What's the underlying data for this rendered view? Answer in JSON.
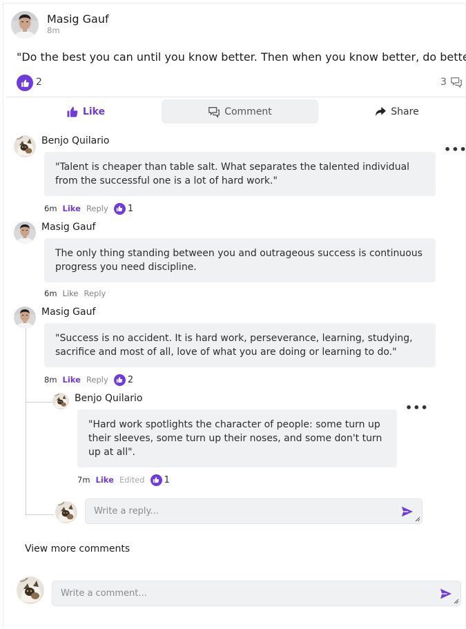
{
  "post": {
    "author": "Masig Gauf",
    "time": "8m",
    "text": "\"Do the best you can until you know better. Then when you know better, do better.\"",
    "like_count": "2",
    "comment_count": "3"
  },
  "actions": {
    "like": "Like",
    "comment": "Comment",
    "share": "Share"
  },
  "comments": [
    {
      "author": "Benjo Quilario",
      "text": "\"Talent is cheaper than table salt. What separates the talented individual from the successful one is a lot of hard work.\"",
      "time": "6m",
      "like": "Like",
      "reply": "Reply",
      "reactions": "1"
    },
    {
      "author": "Masig Gauf",
      "text": "The only thing standing between you and outrageous success is continuous progress you need discipline.",
      "time": "6m",
      "like": "Like",
      "reply": "Reply"
    },
    {
      "author": "Masig Gauf",
      "text": "\"Success is no accident. It is hard work, perseverance, learning, studying, sacrifice and most of all, love of what you are doing or learning to do.\"",
      "time": "8m",
      "like": "Like",
      "reply": "Reply",
      "reactions": "2",
      "replies": [
        {
          "author": "Benjo Quilario",
          "text": "\"Hard work spotlights the character of people: some turn up their sleeves, some turn up their noses, and some don't turn up at all\".",
          "time": "7m",
          "like": "Like",
          "edited": "Edited",
          "reactions": "1"
        }
      ]
    }
  ],
  "reply_input": {
    "placeholder": "Write a reply..."
  },
  "view_more": "View more comments",
  "comment_input": {
    "placeholder": "Write a comment..."
  },
  "colors": {
    "accent": "#6e3cd9",
    "bubble": "#f0f1f3"
  },
  "icons": [
    "thumbs-up-icon",
    "comment-icon",
    "share-icon",
    "more-icon",
    "send-icon"
  ]
}
